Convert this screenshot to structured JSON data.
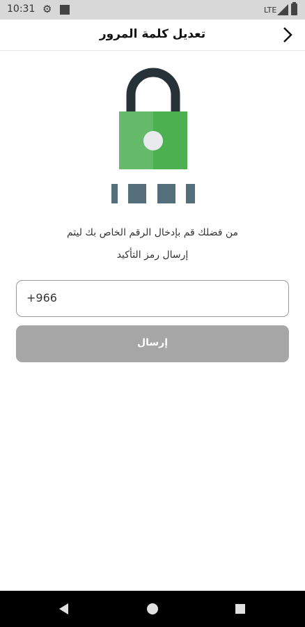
{
  "status_bar": {
    "time": "10:31",
    "network": "LTE",
    "icons": [
      "gear-icon",
      "notification-square-icon",
      "signal-icon",
      "battery-icon"
    ]
  },
  "header": {
    "title": "تعديل كلمة المرور",
    "back_icon": "chevron-right-icon"
  },
  "illustration": {
    "icon": "padlock-icon",
    "code_boxes": 4,
    "colors": {
      "lock_body": "#4caf50",
      "shackle": "#263238",
      "boxes": "#546e7a"
    }
  },
  "instruction": {
    "line1": "من فضلك قم بإدخال الرقم الخاص بك ليتم",
    "line2": "إرسال رمز التأكيد"
  },
  "phone_field": {
    "value": "+966"
  },
  "send_button": {
    "label": "إرسال",
    "color": "#a6a6a6"
  },
  "nav_bar": {
    "items": [
      "back-triangle-icon",
      "home-circle-icon",
      "recents-square-icon"
    ]
  }
}
